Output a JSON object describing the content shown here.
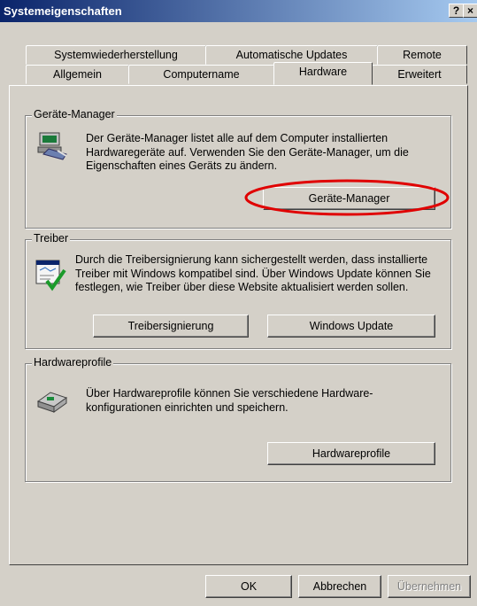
{
  "window": {
    "title": "Systemeigenschaften",
    "help_label": "?",
    "close_label": "×"
  },
  "tabs_row1": [
    "Systemwiederherstellung",
    "Automatische Updates",
    "Remote"
  ],
  "tabs_row2": [
    "Allgemein",
    "Computername",
    "Hardware",
    "Erweitert"
  ],
  "active_tab": "Hardware",
  "device_manager": {
    "label": "Geräte-Manager",
    "description": "Der Geräte-Manager listet alle auf dem Computer installierten Hardwaregeräte auf. Verwenden Sie den Geräte-Manager, um die Eigenschaften eines Geräts zu ändern.",
    "button": "Geräte-Manager",
    "highlight_color": "#e00000"
  },
  "drivers": {
    "label": "Treiber",
    "description": "Durch die Treibersignierung kann sichergestellt werden, dass installierte Treiber mit Windows kompatibel sind. Über Windows Update können Sie festlegen, wie Treiber über diese Website aktualisiert werden sollen.",
    "button_signing": "Treibersignierung",
    "button_update": "Windows Update"
  },
  "hardware_profiles": {
    "label": "Hardwareprofile",
    "description": "Über Hardwareprofile können Sie verschiedene Hardware-konfigurationen einrichten und speichern.",
    "button": "Hardwareprofile"
  },
  "footer": {
    "ok": "OK",
    "cancel": "Abbrechen",
    "apply": "Übernehmen"
  }
}
